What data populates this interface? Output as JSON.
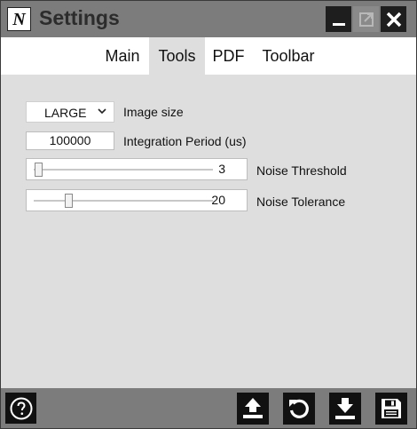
{
  "window": {
    "title": "Settings",
    "logo_letter": "N"
  },
  "tabs": [
    {
      "label": "Main",
      "active": false
    },
    {
      "label": "Tools",
      "active": true
    },
    {
      "label": "PDF",
      "active": false
    },
    {
      "label": "Toolbar",
      "active": false
    }
  ],
  "tools": {
    "image_size": {
      "value": "LARGE",
      "label": "Image size"
    },
    "integration_period": {
      "value": "100000",
      "label": "Integration Period (us)"
    },
    "noise_threshold": {
      "value": "3",
      "label": "Noise Threshold"
    },
    "noise_tolerance": {
      "value": "20",
      "label": "Noise Tolerance"
    }
  },
  "icons": {
    "logo": "n-logo-icon",
    "minimize": "minimize-icon",
    "maximize": "maximize-icon",
    "close": "close-icon",
    "help": "help-icon",
    "upload": "upload-icon",
    "reset": "reset-icon",
    "download": "download-icon",
    "save": "save-icon"
  },
  "colors": {
    "titlebar": "#7c7c7c",
    "content": "#dedede",
    "button": "#111111"
  }
}
